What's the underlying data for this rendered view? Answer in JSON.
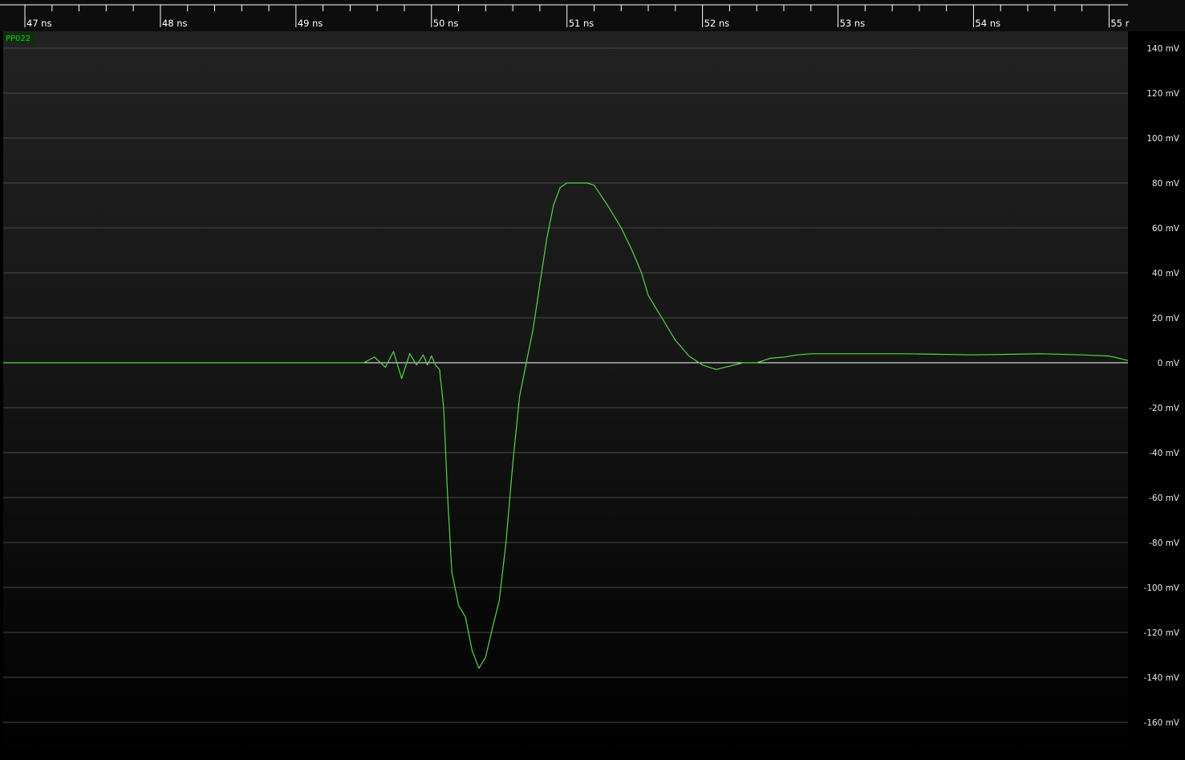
{
  "channel": {
    "name": "PP022",
    "color": "#55d645"
  },
  "time_axis": {
    "labels": [
      "47 ns",
      "48 ns",
      "49 ns",
      "50 ns",
      "51 ns",
      "52 ns",
      "53 ns",
      "54 ns",
      "55 r"
    ],
    "start_ns": 46.84,
    "end_ns": 55.14
  },
  "voltage_axis": {
    "labels": [
      "140 mV",
      "120 mV",
      "100 mV",
      "80 mV",
      "60 mV",
      "40 mV",
      "20 mV",
      "0 mV",
      "-20 mV",
      "-40 mV",
      "-60 mV",
      "-80 mV",
      "-100 mV",
      "-120 mV",
      "-140 mV",
      "-160 mV"
    ],
    "unit": "mV"
  },
  "waveform": {
    "time_ns": [
      46.84,
      47.0,
      47.5,
      48.0,
      48.5,
      49.0,
      49.5,
      49.58,
      49.66,
      49.72,
      49.78,
      49.84,
      49.89,
      49.94,
      49.97,
      50.0,
      50.03,
      50.06,
      50.09,
      50.12,
      50.15,
      50.2,
      50.25,
      50.3,
      50.35,
      50.4,
      50.45,
      50.5,
      50.55,
      50.6,
      50.65,
      50.7,
      50.75,
      50.8,
      50.85,
      50.9,
      50.95,
      51.0,
      51.05,
      51.1,
      51.15,
      51.2,
      51.3,
      51.4,
      51.48,
      51.55,
      51.6,
      51.7,
      51.8,
      51.9,
      52.0,
      52.1,
      52.2,
      52.3,
      52.4,
      52.5,
      52.6,
      52.7,
      52.8,
      53.0,
      53.2,
      53.5,
      54.0,
      54.5,
      54.8,
      55.0,
      55.14
    ],
    "voltage_mv": [
      0,
      0,
      0,
      0,
      0,
      0,
      0,
      2.5,
      -2,
      5,
      -7,
      4,
      -1,
      3.5,
      -1,
      3,
      -1,
      -3,
      -20,
      -60,
      -93,
      -108,
      -113,
      -128,
      -136,
      -131,
      -118,
      -106,
      -80,
      -45,
      -15,
      0,
      15,
      35,
      55,
      70,
      78,
      80,
      80,
      80,
      80,
      79,
      70,
      60,
      50,
      40,
      30,
      20,
      10,
      3,
      -1,
      -3,
      -1.5,
      0,
      0,
      2,
      2.5,
      3.5,
      4,
      4,
      4,
      4,
      3.5,
      4,
      3.5,
      3,
      1
    ]
  }
}
